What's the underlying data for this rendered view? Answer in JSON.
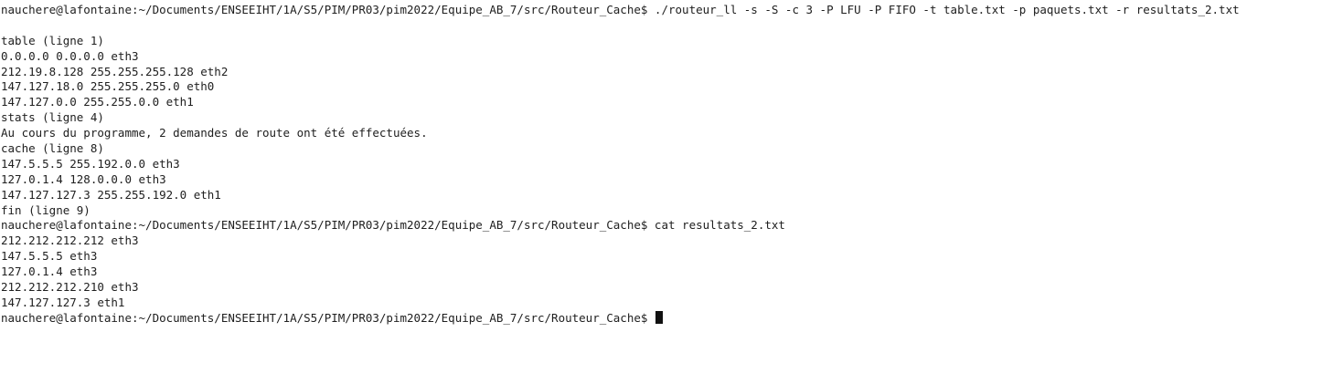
{
  "terminal": {
    "lines": [
      "nauchere@lafontaine:~/Documents/ENSEEIHT/1A/S5/PIM/PR03/pim2022/Equipe_AB_7/src/Routeur_Cache$ ./routeur_ll -s -S -c 3 -P LFU -P FIFO -t table.txt -p paquets.txt -r resultats_2.txt",
      "",
      "table (ligne 1)",
      "0.0.0.0 0.0.0.0 eth3",
      "212.19.8.128 255.255.255.128 eth2",
      "147.127.18.0 255.255.255.0 eth0",
      "147.127.0.0 255.255.0.0 eth1",
      "stats (ligne 4)",
      "Au cours du programme, 2 demandes de route ont été effectuées.",
      "cache (ligne 8)",
      "147.5.5.5 255.192.0.0 eth3",
      "127.0.1.4 128.0.0.0 eth3",
      "147.127.127.3 255.255.192.0 eth1",
      "fin (ligne 9)",
      "nauchere@lafontaine:~/Documents/ENSEEIHT/1A/S5/PIM/PR03/pim2022/Equipe_AB_7/src/Routeur_Cache$ cat resultats_2.txt",
      "212.212.212.212 eth3",
      "147.5.5.5 eth3",
      "127.0.1.4 eth3",
      "212.212.212.210 eth3",
      "147.127.127.3 eth1"
    ],
    "prompt": "nauchere@lafontaine:~/Documents/ENSEEIHT/1A/S5/PIM/PR03/pim2022/Equipe_AB_7/src/Routeur_Cache$ "
  },
  "colors": {
    "background": "#ffffff",
    "text": "#202020",
    "cursor": "#111111"
  }
}
